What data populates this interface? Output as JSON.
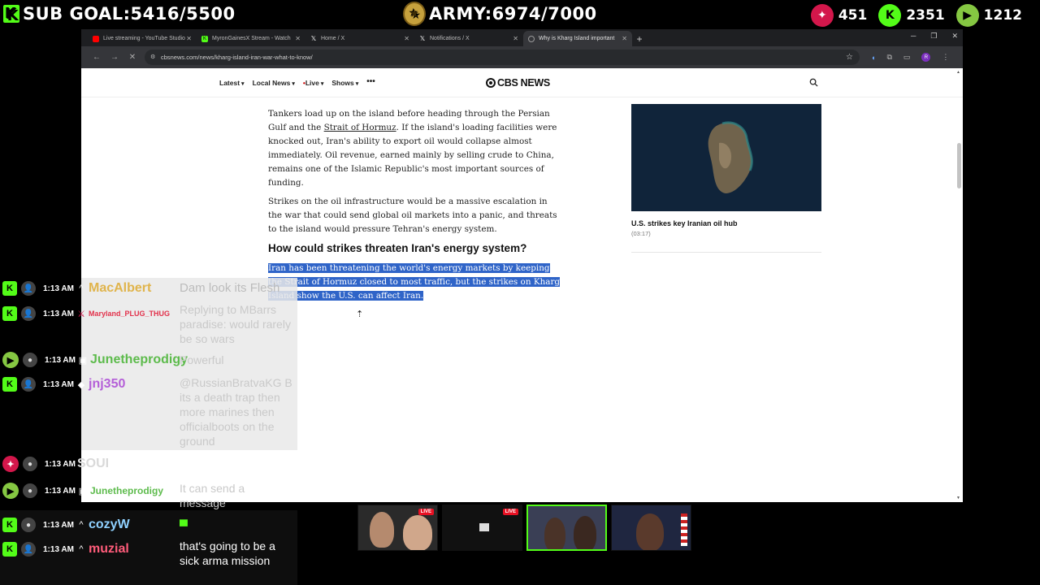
{
  "overlay": {
    "sub_goal": "SUB GOAL:5416/5500",
    "army_goal": "ARMY:6974/7000",
    "counters": [
      {
        "platform": "red-icon",
        "value": "451"
      },
      {
        "platform": "kick-icon",
        "value": "2351"
      },
      {
        "platform": "rumble-icon",
        "value": "1212"
      }
    ]
  },
  "browser": {
    "tabs": [
      {
        "title": "Live streaming - YouTube Studio",
        "color": "#ff0000",
        "icon": "youtube-icon"
      },
      {
        "title": "MyronGainesX Stream - Watch",
        "color": "#53fc18",
        "icon": "kick-icon"
      },
      {
        "title": "Home / X",
        "color": "#ffffff",
        "icon": "x-icon"
      },
      {
        "title": "Notifications / X",
        "color": "#ffffff",
        "icon": "x-icon"
      },
      {
        "title": "Why is Kharg Island important",
        "color": "#888888",
        "icon": "cbs-icon"
      }
    ],
    "url": "cbsnews.com/news/kharg-island-iran-war-what-to-know/",
    "profile_initial": "R"
  },
  "site": {
    "nav": [
      "Latest",
      "Local News",
      "Live",
      "Shows"
    ],
    "logo": "CBS NEWS",
    "article": {
      "p1_before": "Tankers load up on the island before heading through the Persian Gulf and the ",
      "p1_link": "Strait of Hormuz",
      "p1_after": ". If the island's loading facilities were knocked out, Iran's ability to export oil would collapse almost immediately. Oil revenue, earned mainly by selling crude to China, remains one of the Islamic Republic's most important sources of funding.",
      "p2": "Strikes on the oil infrastructure would be a massive escalation in the war that could send global oil markets into a panic, and threats to the island would pressure Tehran's energy system.",
      "heading": "How could strikes threaten Iran's energy system?",
      "p3": "Iran has been threatening the world's energy markets by keeping the Strait of Hormuz closed to most traffic, but the strikes on Kharg Island show the U.S. can affect Iran."
    },
    "video": {
      "title": "U.S. strikes key Iranian oil hub",
      "duration": "(03:17)"
    }
  },
  "chat": [
    {
      "platform": "kick",
      "time": "1:13 AM",
      "user": "MacAlbert",
      "color": "#e0b44c",
      "text": "Dam look its Flesh",
      "size": 15
    },
    {
      "platform": "kick",
      "time": "1:13 AM",
      "user": "Maryland_PLUG_THUG",
      "color": "#e2314b",
      "text": "Replying to MBarrs paradise: would rarely be so wars",
      "size": 9
    },
    {
      "platform": "rumble",
      "time": "1:13 AM",
      "user": "Junetheprodigy",
      "color": "#5dbb4c",
      "text": "Powerful",
      "size": 15
    },
    {
      "platform": "kick",
      "time": "1:13 AM",
      "user": "jnj350",
      "color": "#b45fd8",
      "text": "@RussianBratvaKG B its a death trap then more marines then officialboots on the ground",
      "size": 15
    },
    {
      "platform": "red",
      "time": "1:13 AM",
      "user": "SOUI",
      "color": "#d9d9d9",
      "text": "",
      "size": 15
    },
    {
      "platform": "rumble",
      "time": "1:13 AM",
      "user": "Junetheprodigy",
      "color": "#5dbb4c",
      "text": "It can send a message",
      "size": 12
    },
    {
      "platform": "kick",
      "time": "1:13 AM",
      "user": "cozyW",
      "color": "#8fd1ff",
      "text": "",
      "size": 15
    },
    {
      "platform": "kick",
      "time": "1:13 AM",
      "user": "muzial",
      "color": "#ff5c7a",
      "text": "that's going to be a sick arma mission",
      "size": 15
    }
  ],
  "cams": [
    {
      "live": "LIVE"
    },
    {
      "live": "LIVE"
    },
    {
      "live": ""
    },
    {
      "live": ""
    }
  ]
}
